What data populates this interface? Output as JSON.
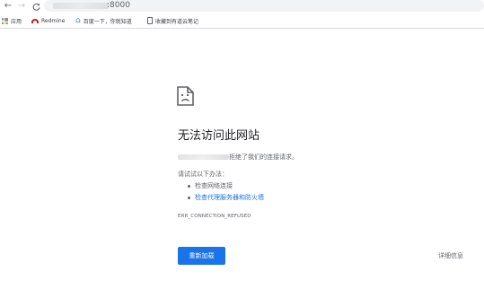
{
  "browser": {
    "back_icon": "arrow-left-icon",
    "forward_icon": "arrow-right-icon",
    "reload_icon": "reload-icon",
    "url_port": ":8000"
  },
  "bookmarks": {
    "items": [
      {
        "label": "应用",
        "icon": "apps-grid-icon"
      },
      {
        "label": "Redmine",
        "icon": "redmine-icon"
      },
      {
        "label": "百度一下，你就知道",
        "icon": "baidu-paw-icon"
      },
      {
        "label": "收藏到有道云笔记",
        "icon": "page-icon"
      }
    ]
  },
  "error": {
    "icon": "sad-page-icon",
    "title": "无法访问此网站",
    "description": "拒绝了我们的连接请求。",
    "try_heading": "请试试以下办法：",
    "suggestions": [
      {
        "label": "检查网络连接",
        "link": false
      },
      {
        "label": "检查代理服务器和防火墙",
        "link": true
      }
    ],
    "code": "ERR_CONNECTION_REFUSED",
    "reload_label": "重新加载",
    "details_label": "详细信息"
  },
  "colors": {
    "primary": "#1a73e8",
    "text": "#202124",
    "secondary_text": "#5f6368"
  }
}
